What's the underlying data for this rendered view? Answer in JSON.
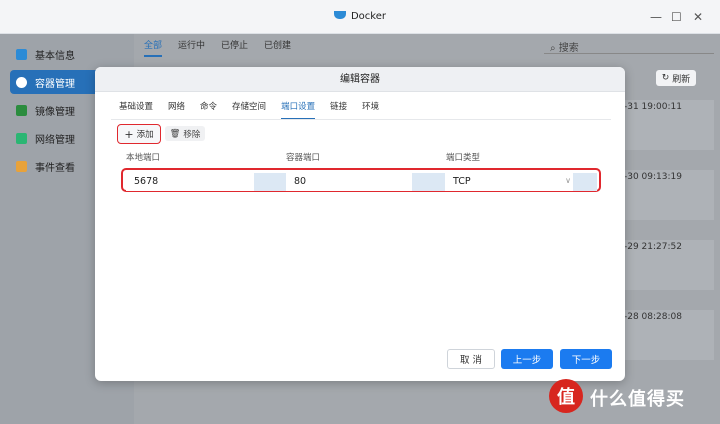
{
  "window": {
    "title": "Docker",
    "minimize": "—",
    "maximize": "☐",
    "close": "✕"
  },
  "sidebar": {
    "items": [
      {
        "label": "基本信息",
        "icon_color": "#2c8bd6"
      },
      {
        "label": "容器管理",
        "icon_color": "#ffffff"
      },
      {
        "label": "镜像管理",
        "icon_color": "#2b8c3e"
      },
      {
        "label": "网络管理",
        "icon_color": "#2bb673"
      },
      {
        "label": "事件查看",
        "icon_color": "#e8a23a"
      }
    ]
  },
  "main": {
    "tabs": [
      "全部",
      "运行中",
      "已停止",
      "已创建"
    ],
    "search_placeholder": "搜索",
    "refresh_label": "刷新",
    "times": [
      "-31 19:00:11",
      "-30 09:13:19",
      "-29 21:27:52",
      "-28 08:28:08"
    ]
  },
  "modal": {
    "title": "编辑容器",
    "tabs": [
      "基础设置",
      "网络",
      "命令",
      "存储空间",
      "端口设置",
      "链接",
      "环境"
    ],
    "add_label": "添加",
    "remove_label": "移除",
    "columns": [
      "本地端口",
      "容器端口",
      "端口类型"
    ],
    "row": {
      "local_port": "5678",
      "container_port": "80",
      "type": "TCP"
    },
    "cancel_label": "取 消",
    "prev_label": "上一步",
    "next_label": "下一步"
  },
  "watermark": {
    "logo": "值",
    "text": "什么值得买"
  }
}
